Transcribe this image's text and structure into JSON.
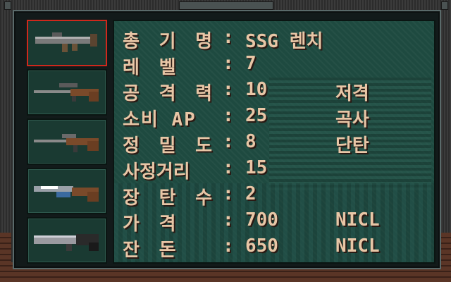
{
  "weapons": [
    {
      "name": "rocket-launcher",
      "selected": true
    },
    {
      "name": "sniper-rifle",
      "selected": false
    },
    {
      "name": "assault-rifle",
      "selected": false
    },
    {
      "name": "shotgun",
      "selected": false
    },
    {
      "name": "heavy-gun",
      "selected": false
    }
  ],
  "stats": [
    {
      "label": "총 기 명",
      "value": "SSG 렌치",
      "extra": ""
    },
    {
      "label": "레   벨",
      "value": "7",
      "extra": ""
    },
    {
      "label": "공 격 력",
      "value": "10",
      "extra": "저격"
    },
    {
      "label": "소비 AP",
      "value": "25",
      "extra": "곡사"
    },
    {
      "label": "정 밀 도",
      "value": "8",
      "extra": "단탄"
    },
    {
      "label": "사정거리",
      "value": "15",
      "extra": ""
    },
    {
      "label": "장 탄 수",
      "value": "2",
      "extra": ""
    },
    {
      "label": "가   격",
      "value": "700",
      "extra": "NICL"
    },
    {
      "label": "잔   돈",
      "value": "650",
      "extra": "NICL"
    }
  ],
  "colon": ":",
  "colors": {
    "text": "#e8c6a6",
    "panel": "#1e4a40",
    "selected_border": "#d0281c"
  }
}
